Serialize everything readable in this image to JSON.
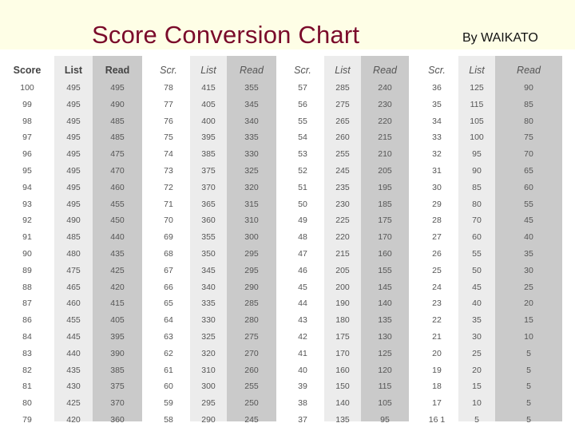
{
  "header": {
    "title": "Score Conversion Chart",
    "byline": "By WAIKATO"
  },
  "colors": {
    "background": "#fefee6",
    "title": "#7a0a2a",
    "list_column": "#ececec",
    "read_column": "#cacaca"
  },
  "table": {
    "groups": [
      {
        "headers": [
          "Score",
          "List",
          "Read"
        ],
        "header_style": "bold",
        "rows": [
          [
            "100",
            "495",
            "495"
          ],
          [
            "99",
            "495",
            "490"
          ],
          [
            "98",
            "495",
            "485"
          ],
          [
            "97",
            "495",
            "485"
          ],
          [
            "96",
            "495",
            "475"
          ],
          [
            "95",
            "495",
            "470"
          ],
          [
            "94",
            "495",
            "460"
          ],
          [
            "93",
            "495",
            "455"
          ],
          [
            "92",
            "490",
            "450"
          ],
          [
            "91",
            "485",
            "440"
          ],
          [
            "90",
            "480",
            "435"
          ],
          [
            "89",
            "475",
            "425"
          ],
          [
            "88",
            "465",
            "420"
          ],
          [
            "87",
            "460",
            "415"
          ],
          [
            "86",
            "455",
            "405"
          ],
          [
            "84",
            "445",
            "395"
          ],
          [
            "83",
            "440",
            "390"
          ],
          [
            "82",
            "435",
            "385"
          ],
          [
            "81",
            "430",
            "375"
          ],
          [
            "80",
            "425",
            "370"
          ],
          [
            "79",
            "420",
            "360"
          ]
        ]
      },
      {
        "headers": [
          "Scr.",
          "List",
          "Read"
        ],
        "header_style": "italic",
        "rows": [
          [
            "78",
            "415",
            "355"
          ],
          [
            "77",
            "405",
            "345"
          ],
          [
            "76",
            "400",
            "340"
          ],
          [
            "75",
            "395",
            "335"
          ],
          [
            "74",
            "385",
            "330"
          ],
          [
            "73",
            "375",
            "325"
          ],
          [
            "72",
            "370",
            "320"
          ],
          [
            "71",
            "365",
            "315"
          ],
          [
            "70",
            "360",
            "310"
          ],
          [
            "69",
            "355",
            "300"
          ],
          [
            "68",
            "350",
            "295"
          ],
          [
            "67",
            "345",
            "295"
          ],
          [
            "66",
            "340",
            "290"
          ],
          [
            "65",
            "335",
            "285"
          ],
          [
            "64",
            "330",
            "280"
          ],
          [
            "63",
            "325",
            "275"
          ],
          [
            "62",
            "320",
            "270"
          ],
          [
            "61",
            "310",
            "260"
          ],
          [
            "60",
            "300",
            "255"
          ],
          [
            "59",
            "295",
            "250"
          ],
          [
            "58",
            "290",
            "245"
          ]
        ]
      },
      {
        "headers": [
          "Scr.",
          "List",
          "Read"
        ],
        "header_style": "italic",
        "rows": [
          [
            "57",
            "285",
            "240"
          ],
          [
            "56",
            "275",
            "230"
          ],
          [
            "55",
            "265",
            "220"
          ],
          [
            "54",
            "260",
            "215"
          ],
          [
            "53",
            "255",
            "210"
          ],
          [
            "52",
            "245",
            "205"
          ],
          [
            "51",
            "235",
            "195"
          ],
          [
            "50",
            "230",
            "185"
          ],
          [
            "49",
            "225",
            "175"
          ],
          [
            "48",
            "220",
            "170"
          ],
          [
            "47",
            "215",
            "160"
          ],
          [
            "46",
            "205",
            "155"
          ],
          [
            "45",
            "200",
            "145"
          ],
          [
            "44",
            "190",
            "140"
          ],
          [
            "43",
            "180",
            "135"
          ],
          [
            "42",
            "175",
            "130"
          ],
          [
            "41",
            "170",
            "125"
          ],
          [
            "40",
            "160",
            "120"
          ],
          [
            "39",
            "150",
            "115"
          ],
          [
            "38",
            "140",
            "105"
          ],
          [
            "37",
            "135",
            "95"
          ]
        ]
      },
      {
        "headers": [
          "Scr.",
          "List",
          "Read"
        ],
        "header_style": "italic",
        "rows": [
          [
            "36",
            "125",
            "90"
          ],
          [
            "35",
            "115",
            "85"
          ],
          [
            "34",
            "105",
            "80"
          ],
          [
            "33",
            "100",
            "75"
          ],
          [
            "32",
            "95",
            "70"
          ],
          [
            "31",
            "90",
            "65"
          ],
          [
            "30",
            "85",
            "60"
          ],
          [
            "29",
            "80",
            "55"
          ],
          [
            "28",
            "70",
            "45"
          ],
          [
            "27",
            "60",
            "40"
          ],
          [
            "26",
            "55",
            "35"
          ],
          [
            "25",
            "50",
            "30"
          ],
          [
            "24",
            "45",
            "25"
          ],
          [
            "23",
            "40",
            "20"
          ],
          [
            "22",
            "35",
            "15"
          ],
          [
            "21",
            "30",
            "10"
          ],
          [
            "20",
            "25",
            "5"
          ],
          [
            "19",
            "20",
            "5"
          ],
          [
            "18",
            "15",
            "5"
          ],
          [
            "17",
            "10",
            "5"
          ],
          [
            "16 1",
            "5",
            "5"
          ]
        ]
      }
    ]
  }
}
